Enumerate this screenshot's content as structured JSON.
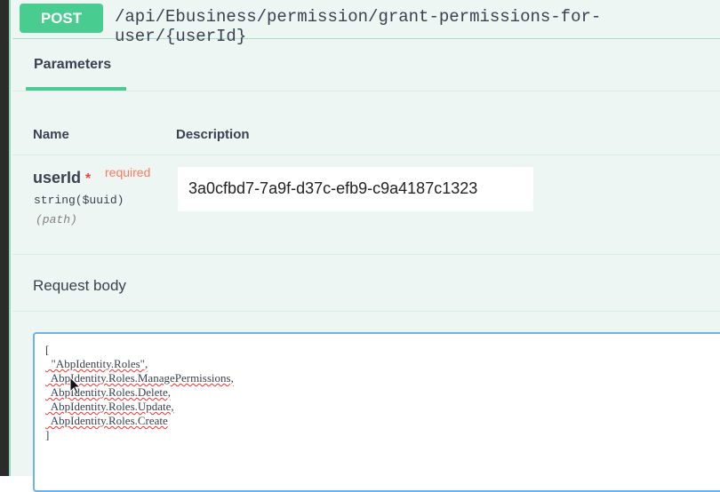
{
  "operation": {
    "method": "POST",
    "path": "/api/Ebusiness/permission/grant-permissions-for-user/{userId}"
  },
  "tabs": {
    "parameters": "Parameters"
  },
  "table": {
    "name_header": "Name",
    "description_header": "Description"
  },
  "param": {
    "name": "userId",
    "required_star": "*",
    "required_label": "required",
    "type": "string($uuid)",
    "in": "(path)",
    "value": "3a0cfbd7-7a9f-d37c-efb9-c9a4187c1323"
  },
  "request_body": {
    "label": "Request body",
    "lines": [
      "[",
      "  \"AbpIdentity.Roles\",",
      "  AbpIdentity.Roles.ManagePermissions,",
      "  AbpIdentity.Roles.Delete,",
      "  AbpIdentity.Roles.Update,",
      "  AbpIdentity.Roles.Create",
      "]"
    ]
  },
  "colors": {
    "accent": "#49cc90",
    "required": "#f93e3e"
  }
}
